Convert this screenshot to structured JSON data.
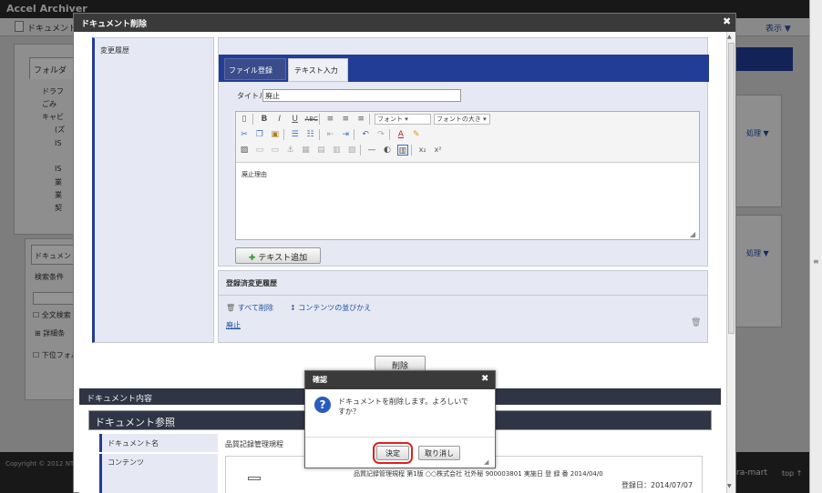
{
  "app": {
    "title": "Accel Archiver",
    "breadcrumb": "ドキュメント削",
    "view_menu": "表示",
    "sidebar": {
      "folder_tab": "フォルダ",
      "tree": [
        "ドラフ",
        "ごみ",
        "キャビ",
        "(ズ",
        "IS",
        "IS",
        "業",
        "業",
        "契"
      ],
      "doc_tab": "ドキュメン",
      "search_condition": "検索条件",
      "fulltext": "全文検索",
      "detail": "詳細条",
      "lower_folder": "下位フォル"
    },
    "right_process_1": "処理",
    "right_process_2": "処理",
    "copyright": "Copyright © 2012 NT",
    "brand": "ra-mart",
    "top_link": "top"
  },
  "modal": {
    "title": "ドキュメント削除",
    "left_panel_label": "変更履歴",
    "tabs": [
      "ファイル登録",
      "テキスト入力"
    ],
    "title_label": "タイトル",
    "title_value": "廃止",
    "font_select": "フォント",
    "font_size_select": "フォントの大き",
    "editor_text": "廃止理由",
    "add_text_button": "テキスト追加",
    "history_section_title": "登録済変更履歴",
    "delete_all": "すべて削除",
    "reorder": "コンテンツの並びかえ",
    "history_item": "廃止",
    "delete_button": "削除",
    "doc_content_header": "ドキュメント内容",
    "doc_ref_header": "ドキュメント参照",
    "doc_name_label": "ドキュメント名",
    "doc_name_value": "品質記録管理規程",
    "content_label": "コンテンツ",
    "content_line1": "品質記録管理規程 第1版 ○○株式会社 社外秘 900003801 実施日 登 録 番 2014/04/0",
    "content_line2": "登録日：2014/07/07"
  },
  "dialog": {
    "title": "確認",
    "message": "ドキュメントを削除します。よろしいですか？",
    "ok_button": "決定",
    "cancel_button": "取り消し"
  },
  "colors": {
    "tab_strip": "#213d96",
    "overlay": "rgba(0,0,0,0.42)",
    "highlight_ring": "#e02020",
    "question_icon": "#2a5bbf"
  }
}
